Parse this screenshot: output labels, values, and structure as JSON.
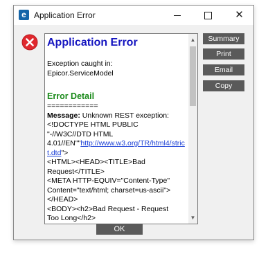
{
  "window": {
    "title": "Application Error",
    "app_icon_letter": "e",
    "minimize_icon": "minimize-icon",
    "maximize_icon": "maximize-icon",
    "close_glyph": "✕"
  },
  "message": {
    "title": "Application Error",
    "caught_line1": "Exception caught in:",
    "caught_line2": "Epicor.ServiceModel",
    "detail_heading": "Error Detail",
    "separator": "============",
    "message_label": "Message:",
    "message_text": " Unknown REST exception:",
    "line1": "<!DOCTYPE HTML PUBLIC",
    "line2": "\"-//W3C//DTD HTML",
    "line3_prefix": "4.01//EN\"\"",
    "link_text": "http://www.w3.org/TR/html4/strict.dtd",
    "line3_suffix": "\">",
    "line4": "<HTML><HEAD><TITLE>Bad",
    "line5": "Request</TITLE>",
    "line6": "<META HTTP-EQUIV=\"Content-Type\"",
    "line7": "Content=\"text/html; charset=us-ascii\">",
    "line8": "</HEAD>",
    "line9": "<BODY><h2>Bad Request - Request",
    "line10": "Too Long</h2>"
  },
  "buttons": {
    "summary": "Summary",
    "print": "Print",
    "email": "Email",
    "copy": "Copy",
    "ok": "OK"
  },
  "colors": {
    "title_blue": "#1515c0",
    "detail_green": "#1a8a1a",
    "button_gray": "#5a5a5a",
    "error_red": "#e0282e"
  },
  "icons": {
    "error": "error-x-icon",
    "scroll_up": "▲",
    "scroll_down": "▼"
  }
}
